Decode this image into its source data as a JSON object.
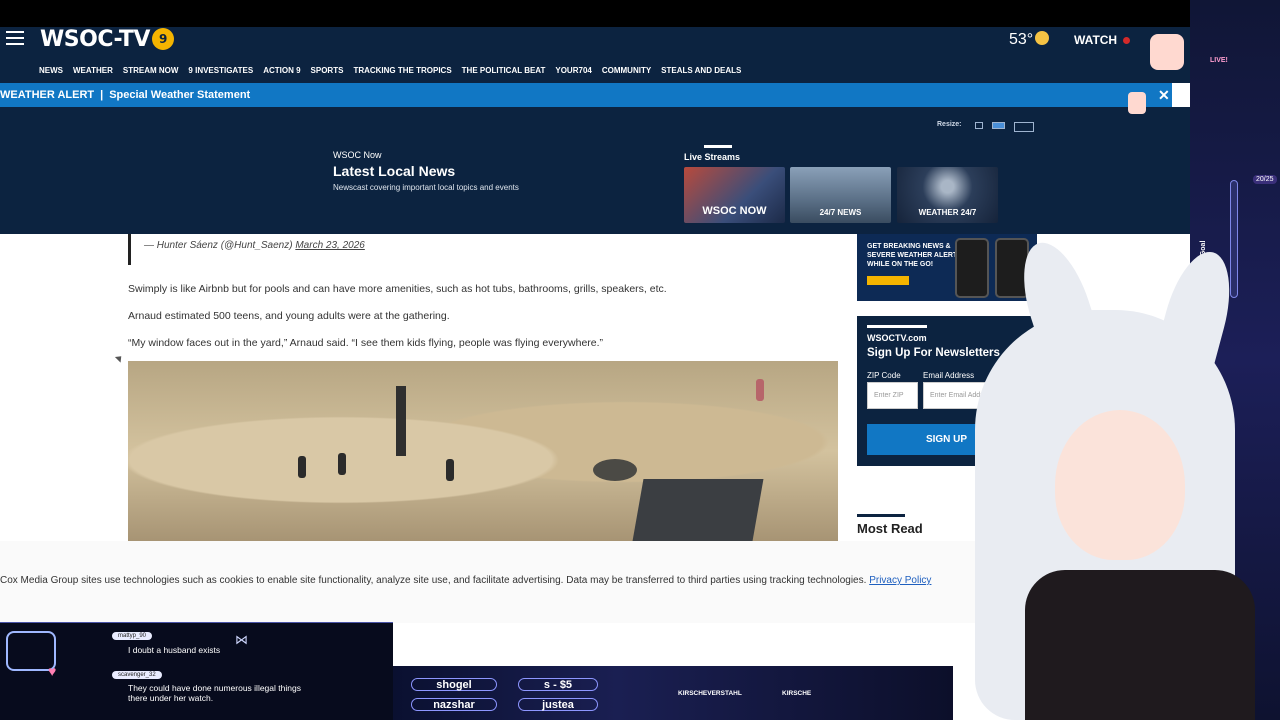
{
  "header": {
    "logo": "WSOC-TV",
    "logo_badge": "9",
    "temperature": "53°",
    "watch_label": "WATCH",
    "nav": [
      "NEWS",
      "WEATHER",
      "STREAM NOW",
      "9 INVESTIGATES",
      "ACTION 9",
      "SPORTS",
      "TRACKING THE TROPICS",
      "THE POLITICAL BEAT",
      "YOUR704",
      "COMMUNITY",
      "STEALS AND DEALS"
    ]
  },
  "alert": {
    "type": "WEATHER ALERT",
    "separator": "|",
    "message": "Special Weather Statement",
    "close": "✕"
  },
  "player": {
    "resize_label": "Resize:",
    "kicker": "WSOC Now",
    "title": "Latest Local News",
    "description": "Newscast covering important local topics and events",
    "live_streams_label": "Live Streams",
    "streams": [
      "WSOC NOW",
      "24/7 NEWS",
      "WEATHER 24/7"
    ]
  },
  "article": {
    "quote_attribution": "— Hunter Sáenz (@Hunt_Saenz)",
    "quote_date": "March 23, 2026",
    "paragraphs": [
      "Swimply is like Airbnb but for pools and can have more amenities, such as hot tubs, bathrooms, grills, speakers, etc.",
      "Arnaud estimated 500 teens, and young adults were at the gathering.",
      "“My window faces out in the yard,” Arnaud said. “I see them kids flying, people was flying everywhere.”"
    ]
  },
  "sidebar": {
    "ad_text": "GET BREAKING NEWS & SEVERE WEATHER ALERTS WHILE ON THE GO!",
    "newsletter": {
      "site": "WSOCTV.com",
      "title": "Sign Up For Newsletters",
      "zip_label": "ZIP Code",
      "zip_placeholder": "Enter ZIP",
      "email_label": "Email Address",
      "email_placeholder": "Enter Email Address",
      "button": "SIGN UP"
    },
    "most_read": "Most Read"
  },
  "cookie": {
    "text": "Cox Media Group sites use technologies such as cookies to enable site functionality, analyze site use, and facilitate advertising. Data may be transferred to third parties using tracking technologies.",
    "link": "Privacy Policy"
  },
  "stream_overlay": {
    "chat": [
      {
        "user": "mattyp_90",
        "message": "I doubt a husband exists"
      },
      {
        "user": "scavenger_32",
        "message": "They could have done numerous illegal things there under her watch."
      }
    ],
    "bar_names": [
      "shogel",
      "nazshar",
      "s - $5",
      "justea"
    ],
    "socials": [
      "KIRSCHEVERSTAHL",
      "KIRSCHE"
    ],
    "live_label": "LIVE!",
    "sub_goal_label": "Daily Sub Goal",
    "sub_goal_count": "20/25"
  }
}
